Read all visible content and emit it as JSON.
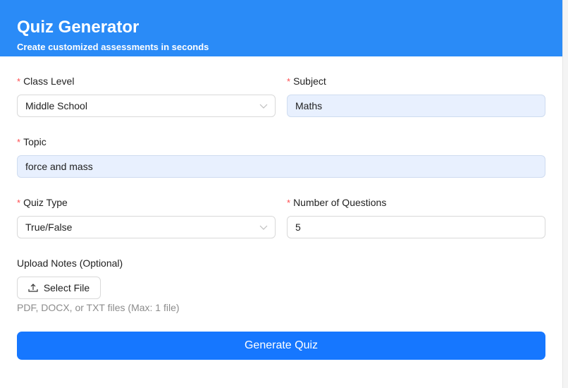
{
  "header": {
    "title": "Quiz Generator",
    "subtitle": "Create customized assessments in seconds"
  },
  "form": {
    "required_mark": "*",
    "class_level": {
      "label": "Class Level",
      "value": "Middle School"
    },
    "subject": {
      "label": "Subject",
      "value": "Maths"
    },
    "topic": {
      "label": "Topic",
      "value": "force and mass"
    },
    "quiz_type": {
      "label": "Quiz Type",
      "value": "True/False"
    },
    "num_questions": {
      "label": "Number of Questions",
      "value": "5"
    },
    "upload": {
      "label": "Upload Notes (Optional)",
      "button_label": "Select File",
      "hint": "PDF, DOCX, or TXT files (Max: 1 file)"
    },
    "submit_label": "Generate Quiz"
  },
  "colors": {
    "header_bg": "#2a8bf7",
    "primary": "#1677ff",
    "required": "#ff4d4f",
    "autofill_bg": "#e8f0fe"
  }
}
